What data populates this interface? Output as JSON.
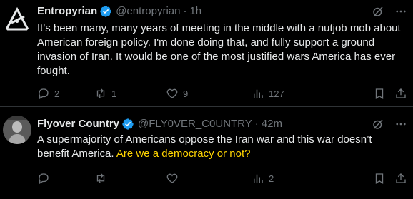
{
  "colors": {
    "background": "#000000",
    "text_primary": "#e7e9ea",
    "text_secondary": "#71767b",
    "divider": "#2f3336",
    "verified_badge": "#1d9bf0",
    "highlight_text": "#ffd400"
  },
  "tweets": [
    {
      "author": {
        "display_name": "Entropyrian",
        "handle": "@entropyrian",
        "verified": true,
        "avatar_icon": "triangle-logo-icon"
      },
      "separator": "·",
      "time": "1h",
      "text": "It's been many, many years of meeting in the middle with a nutjob mob about American foreign policy. I'm done doing that, and fully support a ground invasion of Iran. It would be one of the most justified wars America has ever fought.",
      "highlight": "",
      "counts": {
        "replies": "2",
        "reposts": "1",
        "likes": "9",
        "views": "127"
      }
    },
    {
      "author": {
        "display_name": "Flyover Country",
        "handle": "@FLY0VER_C0UNTRY",
        "verified": true,
        "avatar_icon": "statue-avatar-icon"
      },
      "separator": "·",
      "time": "42m",
      "text": "A supermajority of Americans oppose the Iran war and this war doesn’t benefit America. ",
      "highlight": "Are we a democracy or not?",
      "counts": {
        "replies": "",
        "reposts": "",
        "likes": "",
        "views": "2"
      }
    }
  ]
}
